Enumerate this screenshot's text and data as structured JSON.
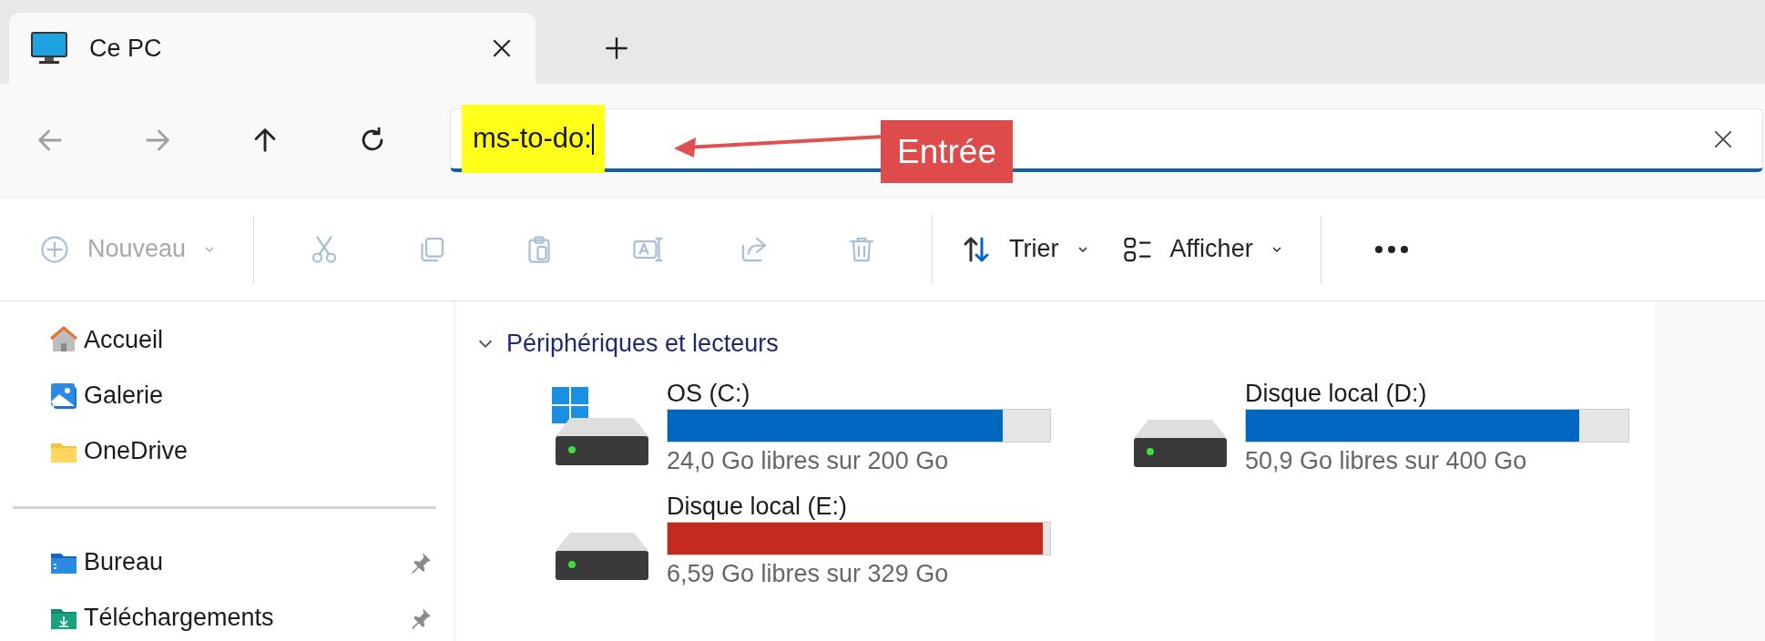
{
  "tab": {
    "title": "Ce PC",
    "selected": true
  },
  "nav_buttons": [
    {
      "kind": "back",
      "disabled": true
    },
    {
      "kind": "forward",
      "disabled": true
    },
    {
      "kind": "up",
      "disabled": false
    },
    {
      "kind": "refresh",
      "disabled": false
    }
  ],
  "address_bar": {
    "value": "ms-to-do:",
    "highlighted": true
  },
  "callout": {
    "label": "Entrée"
  },
  "toolbar": [
    {
      "kind": "new",
      "label": "Nouveau",
      "disabled": true,
      "dropdown": true
    },
    {
      "kind": "cut",
      "disabled": true
    },
    {
      "kind": "copy",
      "disabled": true
    },
    {
      "kind": "paste",
      "disabled": true
    },
    {
      "kind": "rename",
      "disabled": true
    },
    {
      "kind": "share",
      "disabled": true
    },
    {
      "kind": "delete",
      "disabled": true
    },
    {
      "kind": "sort",
      "label": "Trier",
      "disabled": false,
      "dropdown": true
    },
    {
      "kind": "view",
      "label": "Afficher",
      "disabled": false,
      "dropdown": true
    },
    {
      "kind": "more",
      "disabled": false
    }
  ],
  "sidebar": {
    "groups": [
      [
        {
          "kind": "home",
          "label": "Accueil",
          "pinned": false
        },
        {
          "kind": "gallery",
          "label": "Galerie",
          "pinned": false
        },
        {
          "kind": "folder",
          "label": "OneDrive",
          "pinned": false
        }
      ],
      [
        {
          "kind": "desktop",
          "label": "Bureau",
          "pinned": true
        },
        {
          "kind": "download",
          "label": "Téléchargements",
          "pinned": true
        }
      ]
    ]
  },
  "section": {
    "title": "Périphériques et lecteurs",
    "expanded": true
  },
  "drives": [
    {
      "name": "OS (C:)",
      "system": true,
      "level": 0.877,
      "color": "#0067c0",
      "caption": "24,0 Go libres sur 200 Go"
    },
    {
      "name": "Disque local (D:)",
      "system": false,
      "level": 0.871,
      "color": "#0067c0",
      "caption": "50,9 Go libres sur 400 Go"
    },
    {
      "name": "Disque local (E:)",
      "system": false,
      "level": 0.98,
      "color": "#c42b1c",
      "caption": "6,59 Go libres sur 329 Go"
    }
  ]
}
